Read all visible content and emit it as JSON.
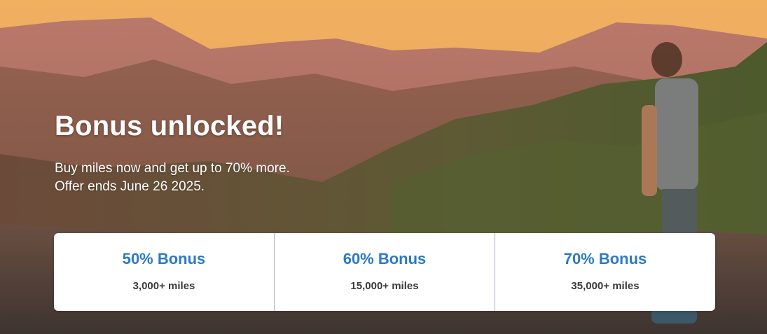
{
  "hero": {
    "headline": "Bonus unlocked!",
    "subtext_line1": "Buy miles now and get up to 70% more.",
    "subtext_line2": "Offer ends June 26 2025."
  },
  "tiers": [
    {
      "title": "50% Bonus",
      "miles": "3,000+ miles"
    },
    {
      "title": "60% Bonus",
      "miles": "15,000+ miles"
    },
    {
      "title": "70% Bonus",
      "miles": "35,000+ miles"
    }
  ],
  "colors": {
    "accent": "#2a7ac8",
    "card_bg": "#ffffff",
    "miles_text": "#3a3a3a"
  }
}
